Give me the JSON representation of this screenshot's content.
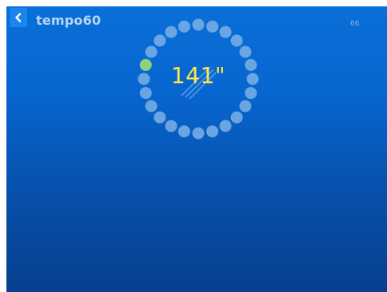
{
  "header": {
    "title": "tempo60",
    "counter": "66"
  },
  "timer": {
    "value": "141\"",
    "dot_count": 24,
    "active_dot_index": 19
  },
  "colors": {
    "background_top": "#0a6fd8",
    "background_bottom": "#073f8e",
    "dot": "#7bb0e6",
    "active_dot": "#8fd07a",
    "timer_text": "#ffe845"
  },
  "icons": {
    "back": "chevron-left-icon"
  }
}
